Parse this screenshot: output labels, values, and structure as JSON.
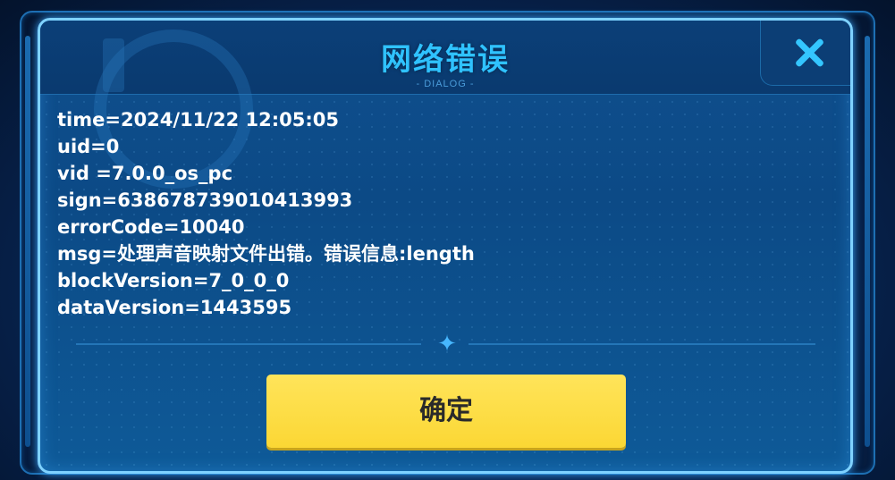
{
  "dialog": {
    "title": "网络错误",
    "subtitle": "- DIALOG -",
    "lines": [
      "time=2024/11/22 12:05:05",
      "uid=0",
      "vid =7.0.0_os_pc",
      "sign=638678739010413993",
      "errorCode=10040",
      "msg=处理声音映射文件出错。错误信息:length",
      "blockVersion=7_0_0_0",
      "dataVersion=1443595"
    ],
    "confirm_label": "确定",
    "close_icon": "close-icon",
    "divider_icon": "four-point-star-icon"
  },
  "colors": {
    "title": "#2fc2ff",
    "button": "#fbd734",
    "frame": "#7fd2ff"
  }
}
